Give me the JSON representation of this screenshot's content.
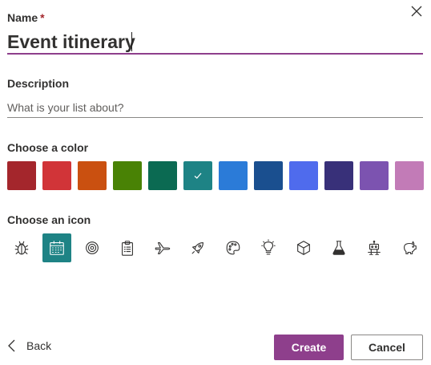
{
  "name": {
    "label": "Name",
    "required_mark": "*",
    "value": "Event itinerary"
  },
  "description": {
    "label": "Description",
    "placeholder": "What is your list about?",
    "value": ""
  },
  "colors": {
    "label": "Choose a color",
    "selected_index": 5,
    "items": [
      "#a4262c",
      "#d13438",
      "#ca5010",
      "#498205",
      "#0b6a52",
      "#1e8385",
      "#2b7bd8",
      "#1a4f8f",
      "#4f6bed",
      "#383079",
      "#7c53b0",
      "#c27bb7"
    ]
  },
  "icons": {
    "label": "Choose an icon",
    "selected_index": 1,
    "items": [
      "bug-icon",
      "calendar-icon",
      "target-icon",
      "clipboard-icon",
      "airplane-icon",
      "rocket-icon",
      "palette-icon",
      "lightbulb-icon",
      "cube-icon",
      "flask-icon",
      "robot-icon",
      "piggy-bank-icon"
    ]
  },
  "actions": {
    "back_label": "Back",
    "create_label": "Create",
    "cancel_label": "Cancel"
  }
}
